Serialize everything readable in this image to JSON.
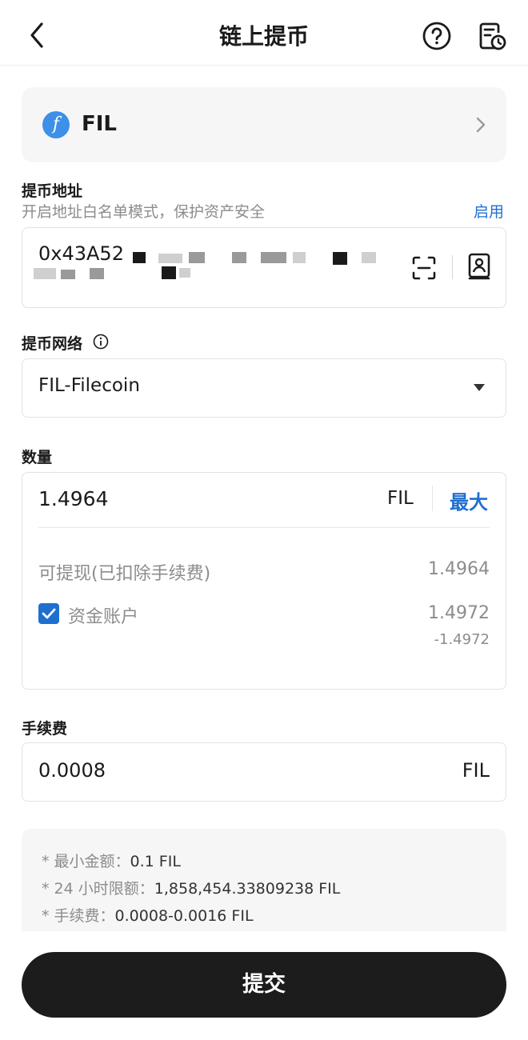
{
  "header": {
    "title": "链上提币"
  },
  "coin": {
    "symbol": "FIL",
    "logo_glyph": "f"
  },
  "address": {
    "label": "提币地址",
    "hint": "开启地址白名单模式，保护资产安全",
    "enable_label": "启用",
    "value_visible": "0x43A52"
  },
  "network": {
    "label": "提币网络",
    "value": "FIL-Filecoin"
  },
  "amount": {
    "label": "数量",
    "value": "1.4964",
    "unit": "FIL",
    "max_label": "最大",
    "withdrawable_label": "可提现(已扣除手续费)",
    "withdrawable_value": "1.4964",
    "account_label": "资金账户",
    "account_checked": true,
    "account_value": "1.4972",
    "account_delta": "-1.4972"
  },
  "fee": {
    "label": "手续费",
    "value": "0.0008",
    "unit": "FIL"
  },
  "notes": [
    {
      "label": "* 最小金额：",
      "value": "0.1 FIL"
    },
    {
      "label": "* 24 小时限额：",
      "value": "1,858,454.33809238 FIL"
    },
    {
      "label": "* 手续费：",
      "value": "0.0008-0.0016 FIL"
    }
  ],
  "submit_label": "提交",
  "colors": {
    "accent": "#1f6fd1",
    "button": "#1c1c1c",
    "coin": "#3d8fe8"
  }
}
